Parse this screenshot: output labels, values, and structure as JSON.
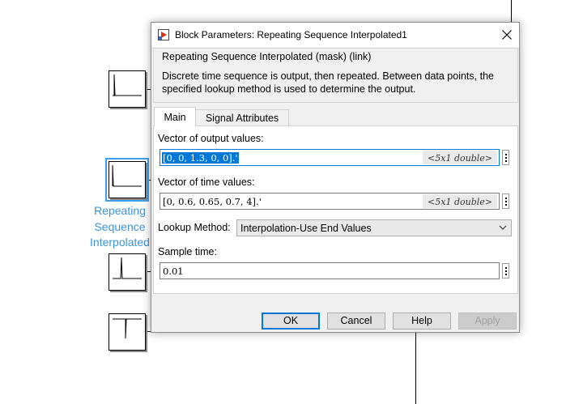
{
  "canvas": {
    "block_label": [
      "Repeating",
      "Sequence",
      "Interpolated"
    ]
  },
  "dialog": {
    "title": "Block Parameters: Repeating Sequence Interpolated1",
    "app_icon": "simulink-block-icon",
    "group": {
      "title": "Repeating Sequence Interpolated (mask) (link)",
      "description": "Discrete time sequence is output, then repeated. Between data points, the specified lookup method is used to determine the output."
    },
    "tabs": [
      {
        "label": "Main",
        "active": true
      },
      {
        "label": "Signal Attributes",
        "active": false
      }
    ],
    "fields": {
      "output_values": {
        "label": "Vector of output values:",
        "value": "[0, 0, 1.3, 0, 0].'",
        "hint": "<5x1 double>"
      },
      "time_values": {
        "label": "Vector of time values:",
        "value": "[0, 0.6, 0.65, 0.7, 4].'",
        "hint": "<5x1 double>"
      },
      "lookup_method": {
        "label": "Lookup Method:",
        "value": "Interpolation-Use End Values"
      },
      "sample_time": {
        "label": "Sample time:",
        "value": "0.01"
      }
    },
    "buttons": {
      "ok": "OK",
      "cancel": "Cancel",
      "help": "Help",
      "apply": "Apply"
    }
  },
  "colors": {
    "selection": "#0078d7",
    "canvas_label": "#3b93dd"
  }
}
